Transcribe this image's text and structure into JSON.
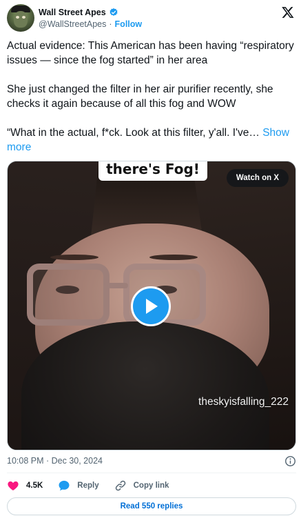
{
  "author": {
    "display_name": "Wall Street Apes",
    "handle": "@WallStreetApes",
    "separator": "·",
    "follow_label": "Follow",
    "verified_icon": "verified-badge-icon",
    "avatar_icon": "avatar-ape"
  },
  "platform_icon": "x-logo-icon",
  "tweet": {
    "paragraphs": [
      "Actual evidence: This American has been having “respiratory issues — since the fog started” in her area",
      "She just changed the filter in her air purifier recently, she checks it again because of all this fog and WOW",
      "“What in the actual, f*ck. Look at this filter, y'all. I've…"
    ],
    "show_more_label": "Show more"
  },
  "media": {
    "caption_overlay": "there's Fog!",
    "watch_label": "Watch on X",
    "play_icon": "play-icon",
    "watermark": "theskyisfalling_222"
  },
  "meta": {
    "timestamp": "10:08 PM · Dec 30, 2024",
    "info_icon": "info-icon"
  },
  "actions": {
    "like_count": "4.5K",
    "reply_label": "Reply",
    "copy_link_label": "Copy link"
  },
  "read_replies_label": "Read 550 replies",
  "colors": {
    "accent": "#1d9bf0",
    "like": "#f91880",
    "text_secondary": "#536471"
  }
}
